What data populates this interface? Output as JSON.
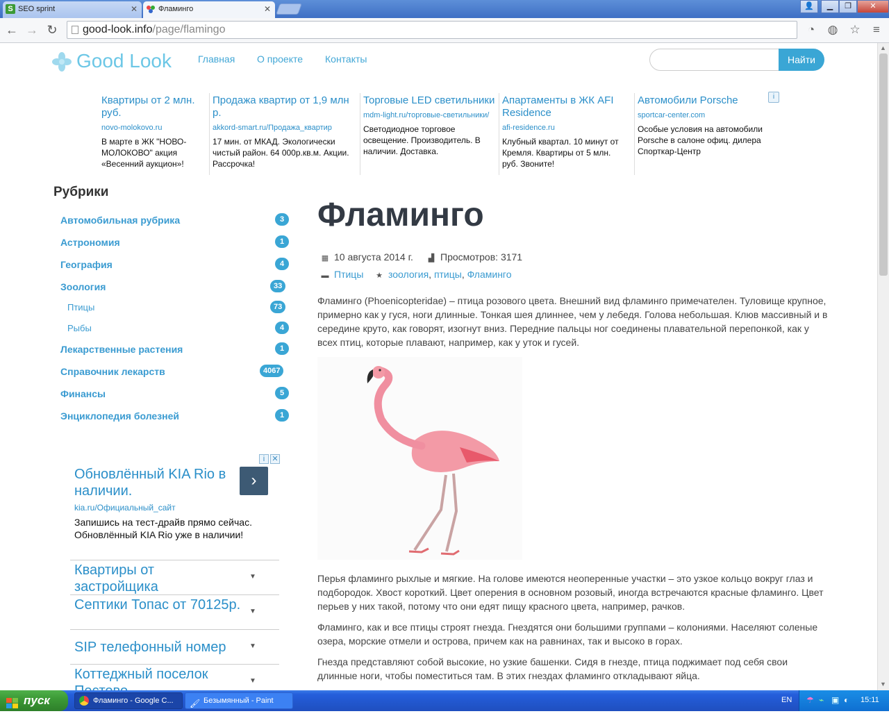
{
  "browser": {
    "tabs": [
      {
        "label": "SEO sprint",
        "icon": "seosprint-favicon-icon"
      },
      {
        "label": "Фламинго",
        "icon": "goodlook-favicon-icon"
      }
    ],
    "address": {
      "domain": "good-look.info",
      "path": "/page/flamingo"
    }
  },
  "site": {
    "logo": "Good Look",
    "nav": [
      "Главная",
      "О проекте",
      "Контакты"
    ],
    "search": {
      "button": "Найти",
      "placeholder": ""
    }
  },
  "top_ads": [
    {
      "title": "Квартиры от 2 млн. руб.",
      "domain": "novo-molokovo.ru",
      "text": "В марте в ЖК \"НОВО-МОЛОКОВО\" акция «Весенний аукцион»!"
    },
    {
      "title": "Продажа квартир от 1,9 млн р.",
      "domain": "akkord-smart.ru/Продажа_квартир",
      "text": "17 мин. от МКАД. Экологически чистый район. 64 000р.кв.м. Акции. Рассрочка!"
    },
    {
      "title": "Торговые LED светильники",
      "domain": "mdm-light.ru/торговые-светильники/",
      "text": "Светодиодное торговое освещение. Производитель. В наличии. Доставка."
    },
    {
      "title": "Апартаменты в ЖК AFI Residence",
      "domain": "afi-residence.ru",
      "text": "Клубный квартал. 10 минут от Кремля. Квартиры от 5 млн. руб. Звоните!"
    },
    {
      "title": "Автомобили Porsche",
      "domain": "sportcar-center.com",
      "text": "Особые условия на автомобили Porsche в салоне офиц. дилера Спорткар-Центр"
    }
  ],
  "sidebar": {
    "title": "Рубрики",
    "categories": [
      {
        "label": "Автомобильная рубрика",
        "count": "3"
      },
      {
        "label": "Астрономия",
        "count": "1"
      },
      {
        "label": "География",
        "count": "4"
      },
      {
        "label": "Зоология",
        "count": "33"
      },
      {
        "label": "Птицы",
        "count": "73"
      },
      {
        "label": "Рыбы",
        "count": "4"
      },
      {
        "label": "Лекарственные растения",
        "count": "1"
      },
      {
        "label": "Справочник лекарств",
        "count": "4067"
      },
      {
        "label": "Финансы",
        "count": "5"
      },
      {
        "label": "Энциклопедия болезней",
        "count": "1"
      }
    ],
    "ad": {
      "title": "Обновлённый KIA Rio в наличии.",
      "domain": "kia.ru/Официальный_сайт",
      "text": "Запишись на тест-драйв прямо сейчас. Обновлённый KIA Rio уже в наличии!",
      "arrow": "›"
    },
    "accordion": [
      "Квартиры от застройщика",
      "Септики Топас от 70125р.",
      "SIP телефонный номер",
      "Коттеджный поселок Пестово"
    ]
  },
  "article": {
    "title": "Фламинго",
    "date": "10 августа 2014 г.",
    "views": "Просмотров: 3171",
    "category": "Птицы",
    "tags": [
      "зоология",
      "птицы",
      "Фламинго"
    ],
    "paragraphs": [
      "Фламинго (Phoenicopteridae) – птица розового цвета. Внешний вид фламинго примечателен. Туловище крупное, примерно как у гуся, ноги длинные. Тонкая шея длиннее, чем у лебедя. Голова небольшая. Клюв массивный и в середине круто, как говорят, изогнут вниз. Передние пальцы ног соединены плавательной перепонкой, как у всех птиц, которые плавают, например, как у уток и гусей.",
      "Перья фламинго рыхлые и мягкие. На голове имеются неоперенные участки – это узкое кольцо вокруг глаз и подбородок. Хвост короткий. Цвет оперения в основном розовый, иногда встречаются красные фламинго. Цвет перьев у них такой, потому что они едят пищу красного цвета, например, рачков.",
      "Фламинго, как и все птицы строят гнезда. Гнездятся они большими группами – колониями. Населяют соленые озера, морские отмели и острова, причем как на равнинах, так и высоко в горах.",
      "Гнезда представляют собой высокие, но узкие башенки. Сидя в гнезде, птица поджимает под себя свои длинные ноги, чтобы поместиться там. В этих гнездах фламинго откладывают яйца."
    ]
  },
  "taskbar": {
    "start": "пуск",
    "items": [
      "Фламинго - Google C...",
      "Безымянный - Paint"
    ],
    "lang": "EN",
    "time": "15:11"
  },
  "colors": {
    "accent": "#3aa6d5",
    "link": "#2b8fc9",
    "title": "#333a44",
    "taskbar": "#245edb",
    "start": "#3c9a36"
  }
}
